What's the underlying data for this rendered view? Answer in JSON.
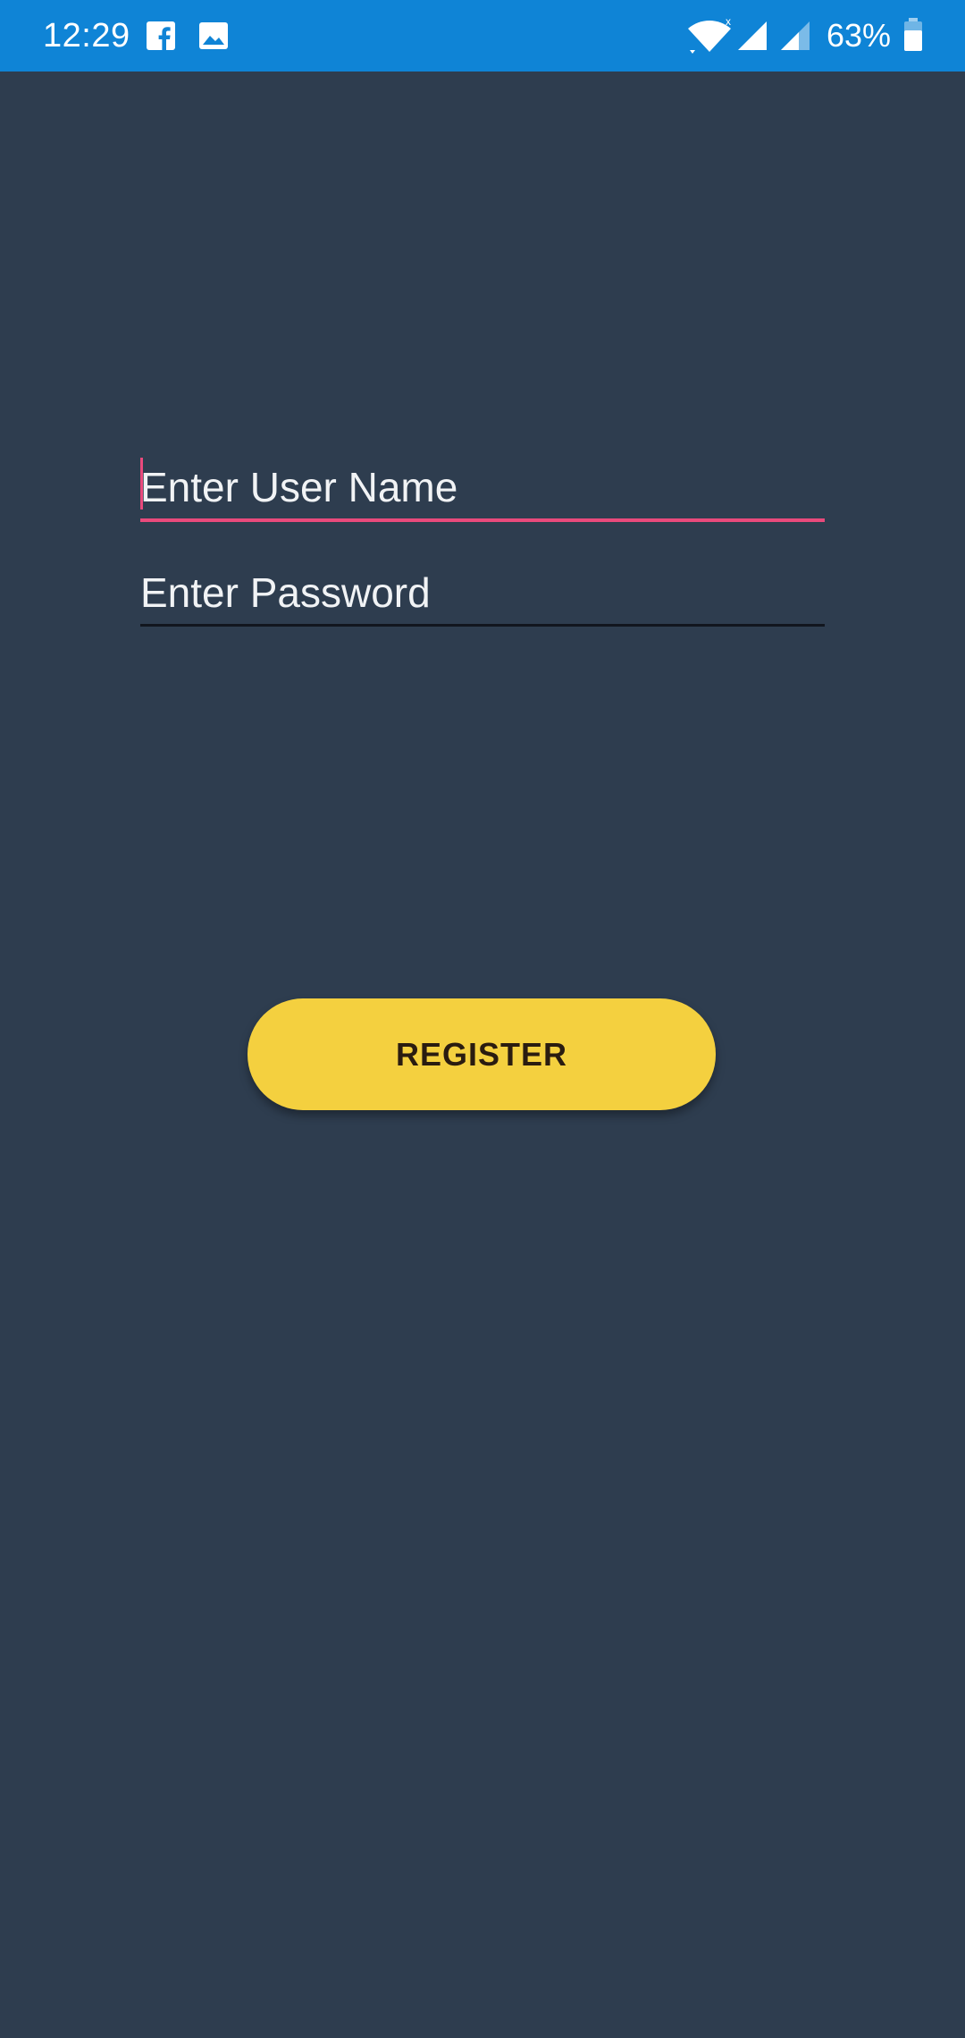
{
  "status_bar": {
    "time": "12:29",
    "battery_percent": "63%",
    "icons": [
      "facebook-icon",
      "image-icon",
      "wifi-icon",
      "cellular-signal-icon",
      "cellular-signal-icon",
      "battery-icon"
    ],
    "background_color": "#0f84d6"
  },
  "form": {
    "username": {
      "placeholder": "Enter User Name",
      "value": ""
    },
    "password": {
      "placeholder": "Enter Password",
      "value": ""
    },
    "register_label": "REGISTER"
  },
  "colors": {
    "background": "#2e3d4f",
    "accent": "#e94a7c",
    "button": "#f4d03f",
    "button_text": "#2a1c10"
  }
}
